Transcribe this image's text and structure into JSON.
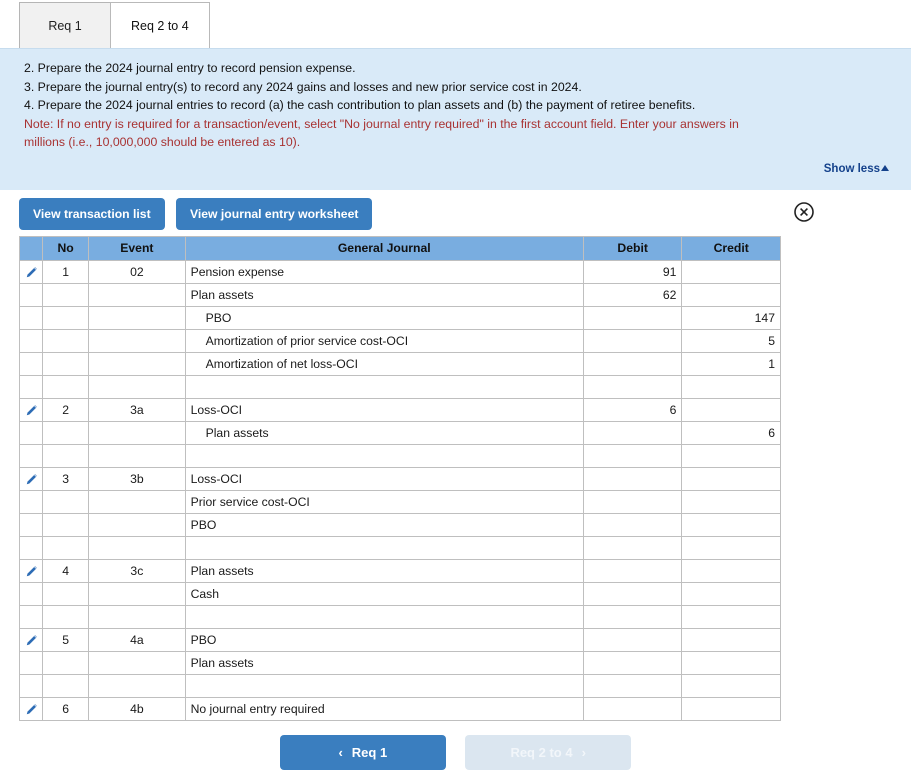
{
  "tabs": [
    {
      "label": "Req 1",
      "active": false
    },
    {
      "label": "Req 2 to 4",
      "active": true
    }
  ],
  "instructions": {
    "line2": "2. Prepare the 2024 journal entry to record pension expense.",
    "line3": "3. Prepare the journal entry(s) to record any 2024 gains and losses and new prior service cost in 2024.",
    "line4": "4. Prepare the 2024 journal entries to record (a) the cash contribution to plan assets and (b) the payment of retiree benefits.",
    "note_line1": "Note: If no entry is required for a transaction/event, select \"No journal entry required\" in the first account field. Enter your answers in",
    "note_line2": "millions (i.e., 10,000,000 should be entered as 10).",
    "show_less": "Show less"
  },
  "toolbar": {
    "view_transaction_list": "View transaction list",
    "view_journal_entry_worksheet": "View journal entry worksheet",
    "close_icon": "close-circle-icon"
  },
  "table": {
    "headers": {
      "no": "No",
      "event": "Event",
      "general_journal": "General Journal",
      "debit": "Debit",
      "credit": "Credit"
    },
    "rows": [
      {
        "type": "entry",
        "edit": true,
        "no": "1",
        "event": "02",
        "account": "Pension expense",
        "indent": false,
        "debit": "91",
        "credit": ""
      },
      {
        "type": "entry",
        "edit": false,
        "no": "",
        "event": "",
        "account": "Plan assets",
        "indent": false,
        "debit": "62",
        "credit": ""
      },
      {
        "type": "entry",
        "edit": false,
        "no": "",
        "event": "",
        "account": "PBO",
        "indent": true,
        "debit": "",
        "credit": "147"
      },
      {
        "type": "entry",
        "edit": false,
        "no": "",
        "event": "",
        "account": "Amortization of prior service cost-OCI",
        "indent": true,
        "debit": "",
        "credit": "5"
      },
      {
        "type": "entry",
        "edit": false,
        "no": "",
        "event": "",
        "account": "Amortization of net loss-OCI",
        "indent": true,
        "debit": "",
        "credit": "1"
      },
      {
        "type": "spacer",
        "edit": false,
        "no": "",
        "event": "",
        "account": "",
        "indent": false,
        "debit": "",
        "credit": ""
      },
      {
        "type": "entry",
        "edit": true,
        "no": "2",
        "event": "3a",
        "account": "Loss-OCI",
        "indent": false,
        "debit": "6",
        "credit": ""
      },
      {
        "type": "entry",
        "edit": false,
        "no": "",
        "event": "",
        "account": "Plan assets",
        "indent": true,
        "debit": "",
        "credit": "6"
      },
      {
        "type": "spacer",
        "edit": false,
        "no": "",
        "event": "",
        "account": "",
        "indent": false,
        "debit": "",
        "credit": ""
      },
      {
        "type": "entry",
        "edit": true,
        "no": "3",
        "event": "3b",
        "account": "Loss-OCI",
        "indent": false,
        "debit": "",
        "credit": ""
      },
      {
        "type": "entry",
        "edit": false,
        "no": "",
        "event": "",
        "account": "Prior service cost-OCI",
        "indent": false,
        "debit": "",
        "credit": ""
      },
      {
        "type": "entry",
        "edit": false,
        "no": "",
        "event": "",
        "account": "PBO",
        "indent": false,
        "debit": "",
        "credit": ""
      },
      {
        "type": "spacer",
        "edit": false,
        "no": "",
        "event": "",
        "account": "",
        "indent": false,
        "debit": "",
        "credit": ""
      },
      {
        "type": "entry",
        "edit": true,
        "no": "4",
        "event": "3c",
        "account": "Plan assets",
        "indent": false,
        "debit": "",
        "credit": ""
      },
      {
        "type": "entry",
        "edit": false,
        "no": "",
        "event": "",
        "account": "Cash",
        "indent": false,
        "debit": "",
        "credit": ""
      },
      {
        "type": "spacer",
        "edit": false,
        "no": "",
        "event": "",
        "account": "",
        "indent": false,
        "debit": "",
        "credit": ""
      },
      {
        "type": "entry",
        "edit": true,
        "no": "5",
        "event": "4a",
        "account": "PBO",
        "indent": false,
        "debit": "",
        "credit": ""
      },
      {
        "type": "entry",
        "edit": false,
        "no": "",
        "event": "",
        "account": "Plan assets",
        "indent": false,
        "debit": "",
        "credit": ""
      },
      {
        "type": "spacer",
        "edit": false,
        "no": "",
        "event": "",
        "account": "",
        "indent": false,
        "debit": "",
        "credit": ""
      },
      {
        "type": "entry",
        "edit": true,
        "no": "6",
        "event": "4b",
        "account": "No journal entry required",
        "indent": false,
        "debit": "",
        "credit": ""
      }
    ]
  },
  "nav": {
    "prev_label": "Req 1",
    "next_label": "Req 2 to 4",
    "prev_chevron": "‹",
    "next_chevron": "›",
    "next_disabled": true
  },
  "colors": {
    "accent_blue": "#3a7ebf",
    "table_header_blue": "#79ade0",
    "info_panel_blue": "#d9eaf8",
    "note_red": "#a83232",
    "link_blue": "#14418b",
    "disabled_button": "#dbe6f0"
  }
}
